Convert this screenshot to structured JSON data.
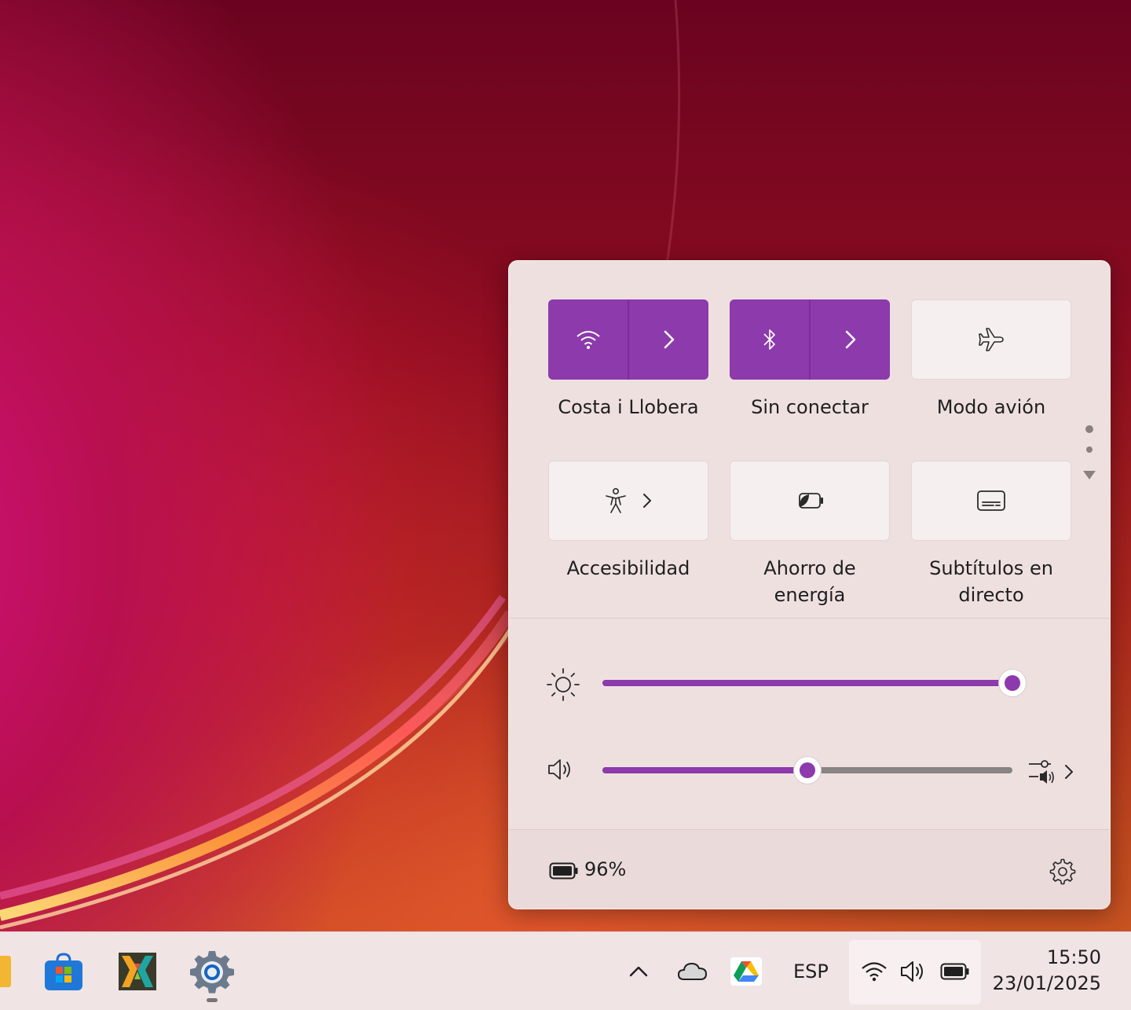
{
  "quick_settings": {
    "tiles": [
      {
        "label": "Costa i Llobera",
        "icon": "wifi-icon",
        "active": true
      },
      {
        "label": "Sin conectar",
        "icon": "bluetooth-icon",
        "active": true
      },
      {
        "label": "Modo avión",
        "icon": "airplane-icon",
        "active": false
      },
      {
        "label": "Accesibilidad",
        "icon": "accessibility-icon",
        "active": false
      },
      {
        "label_line1": "Ahorro de",
        "label_line2": "energía",
        "icon": "battery-saver-icon",
        "active": false
      },
      {
        "label_line1": "Subtítulos en",
        "label_line2": "directo",
        "icon": "live-captions-icon",
        "active": false
      }
    ],
    "brightness_level": 1.0,
    "volume_level": 0.5,
    "battery_percent": "96%",
    "accent_color": "#8c3aac"
  },
  "taskbar": {
    "apps": [
      "file-explorer-icon",
      "microsoft-store-icon",
      "app-icon",
      "settings-icon"
    ],
    "language": "ESP",
    "time": "15:50",
    "date": "23/01/2025"
  }
}
